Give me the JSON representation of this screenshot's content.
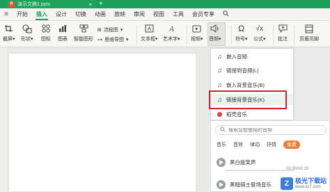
{
  "titlebar": {
    "doc_title": "演示文稿1.pptx",
    "close": "×",
    "new_tab": "+"
  },
  "menu": {
    "items": [
      "开始",
      "插入",
      "设计",
      "切换",
      "动画",
      "放映",
      "审阅",
      "视图",
      "工具",
      "会员专享"
    ],
    "active": "插入"
  },
  "ribbon": {
    "screenshot": "截屏",
    "shape": "形状",
    "icon": "图标",
    "chart": "图表",
    "smart_graphic": "智能图形",
    "flowchart": "流程图",
    "mindmap": "思维导图",
    "textbox": "文本框",
    "wordart": "艺术字",
    "video": "视频",
    "audio": "音频",
    "symbol": "符号",
    "formula": "公式",
    "comment": "批注",
    "header_footer": "页眉页脚",
    "dropdown_arrow": "▾"
  },
  "audio_menu": {
    "items": [
      {
        "label": "嵌入音频",
        "icon": "music-note-icon"
      },
      {
        "label": "链接到音频(L)",
        "icon": "music-note-icon"
      },
      {
        "label": "嵌入背景音乐(B)",
        "icon": "music-note-icon"
      },
      {
        "label": "链接背景音乐(K)",
        "icon": "music-note-icon",
        "highlighted": true
      },
      {
        "label": "稻壳音乐",
        "icon": "red-dot-icon"
      }
    ]
  },
  "music_panel": {
    "search_placeholder": "搜索您想使用的音频",
    "categories": [
      "音乐",
      "音效",
      "律动",
      "抒情",
      "免费"
    ],
    "active_category": "免费",
    "tracks": [
      {
        "title": "黑白能笑声",
        "time": "00:00/00:15"
      },
      {
        "title": "黑暗骑士登场音乐"
      }
    ]
  },
  "watermark": {
    "name": "极光下载站",
    "url": "www.xz7.com",
    "logo": "Z"
  },
  "colors": {
    "accent": "#1d9e58",
    "highlight_box": "#c8242a",
    "free_badge": "#ef7b3a"
  }
}
